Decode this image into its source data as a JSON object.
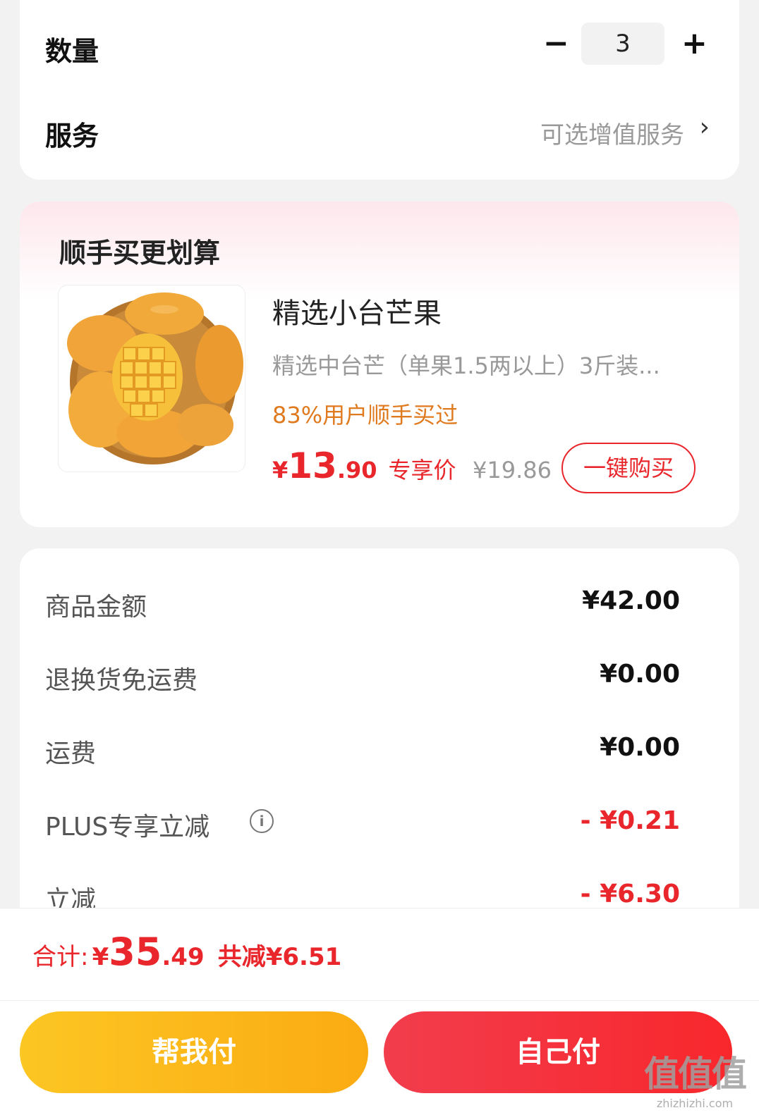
{
  "quantity": {
    "label": "数量",
    "minus": "−",
    "value": "3",
    "plus": "+"
  },
  "service": {
    "label": "服务",
    "value": "可选增值服务",
    "chevron": "›"
  },
  "bundle": {
    "title": "顺手买更划算",
    "product": {
      "name": "精选小台芒果",
      "desc": "精选中台芒（单果1.5两以上）3斤装...",
      "social": "83%用户顺手买过",
      "price_symbol": "¥",
      "price_int": "13",
      "price_dec": ".90",
      "price_tag": "专享价",
      "orig_price": "¥19.86",
      "buy_label": "一键购买"
    }
  },
  "summary": {
    "rows": [
      {
        "label": "商品金额",
        "value": "¥42.00"
      },
      {
        "label": "退换货免运费",
        "value": "¥0.00"
      },
      {
        "label": "运费",
        "value": "¥0.00"
      },
      {
        "label": "PLUS专享立减",
        "value": "- ¥0.21",
        "info_icon": "i"
      },
      {
        "label": "立减",
        "value": "- ¥6.30"
      }
    ]
  },
  "total": {
    "label": "合计:",
    "yen": "¥",
    "int": "35",
    "dec": ".49",
    "saved": "共减¥6.51"
  },
  "buttons": {
    "help_pay": "帮我付",
    "self_pay": "自己付"
  },
  "watermark": {
    "main": "值值值",
    "sub": "zhizhizhi.com"
  },
  "colors": {
    "accent_red": "#e8262b",
    "orange_text": "#e07a1f",
    "help_pay_yellow": "#fbb917",
    "self_pay_red": "#f4313b"
  },
  "icons": {
    "info": "info-icon",
    "chevron": "chevron-right-icon",
    "product_image": "mango-image"
  }
}
